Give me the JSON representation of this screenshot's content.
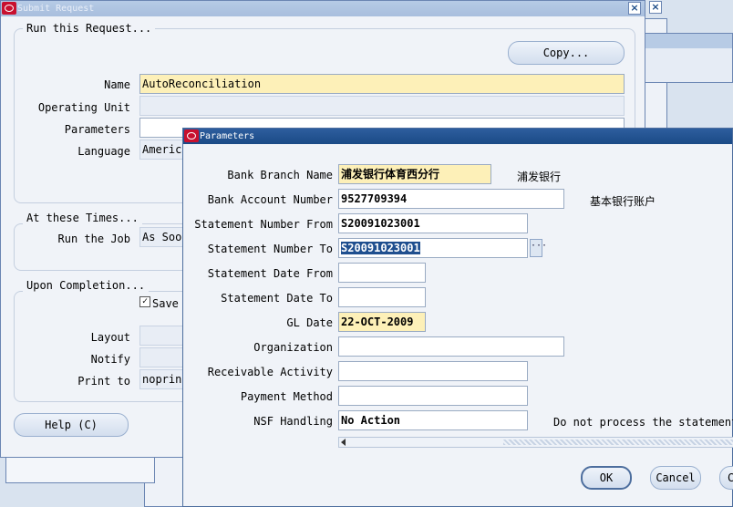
{
  "submit_request": {
    "title": "Submit Request",
    "group_run_title": "Run this Request...",
    "copy_button": "Copy...",
    "name_label": "Name",
    "name_value": "AutoReconciliation",
    "operating_unit_label": "Operating Unit",
    "operating_unit_value": "",
    "parameters_label": "Parameters",
    "parameters_value": "",
    "language_label": "Language",
    "language_value": "America",
    "group_times_title": "At these Times...",
    "run_job_label": "Run the Job",
    "run_job_value": "As Soon",
    "group_completion_title": "Upon Completion...",
    "save_label": "Save",
    "save_checked": true,
    "layout_label": "Layout",
    "notify_label": "Notify",
    "print_to_label": "Print to",
    "print_to_value": "noprint",
    "help_button": "Help (C)"
  },
  "parameters_dialog": {
    "title": "Parameters",
    "fields": [
      {
        "label": "Bank Branch Name",
        "value": "浦发银行体育西分行",
        "desc": "浦发银行"
      },
      {
        "label": "Bank Account Number",
        "value": "9527709394",
        "desc": "基本银行账户"
      },
      {
        "label": "Statement Number From",
        "value": "S20091023001",
        "desc": ""
      },
      {
        "label": "Statement Number To",
        "value": "S20091023001",
        "desc": ""
      },
      {
        "label": "Statement Date From",
        "value": "",
        "desc": ""
      },
      {
        "label": "Statement Date To",
        "value": "",
        "desc": ""
      },
      {
        "label": "GL Date",
        "value": "22-OCT-2009",
        "desc": ""
      },
      {
        "label": "Organization",
        "value": "",
        "desc": ""
      },
      {
        "label": "Receivable Activity",
        "value": "",
        "desc": ""
      },
      {
        "label": "Payment Method",
        "value": "",
        "desc": ""
      },
      {
        "label": "NSF Handling",
        "value": "No Action",
        "desc": "Do not process the statement"
      }
    ],
    "ok_button": "OK",
    "cancel_button": "Cancel",
    "clear_button": "C"
  },
  "icons": {
    "window": "oracle-logo-icon",
    "close": "close-icon",
    "browse": "ellipsis-icon",
    "scroll_left": "left-arrow-icon"
  }
}
